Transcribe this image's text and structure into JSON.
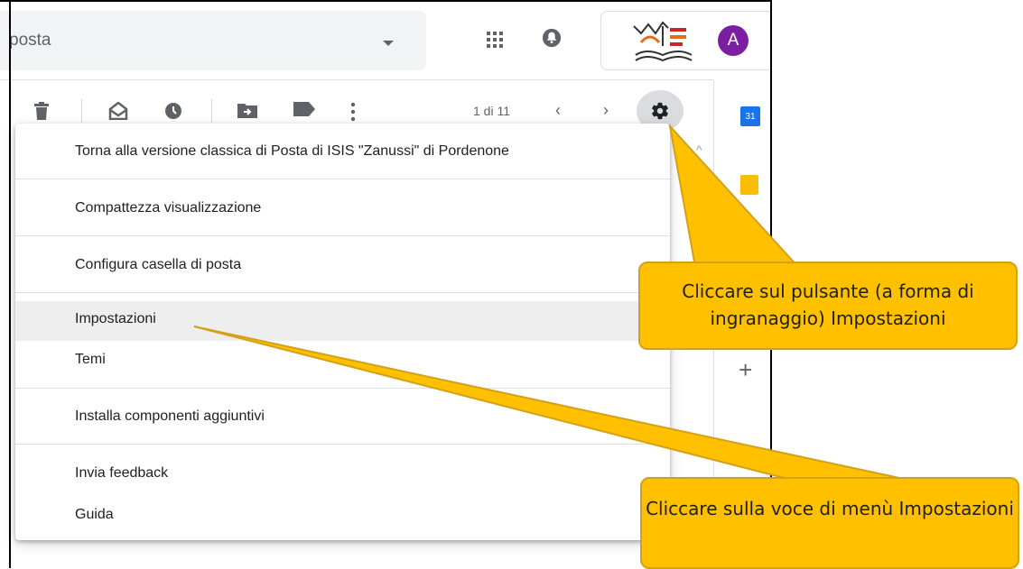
{
  "header": {
    "search_text": "posta",
    "avatar_letter": "A"
  },
  "toolbar": {
    "pager": "1 di 11",
    "prev": "‹",
    "next": "›"
  },
  "side_rail": {
    "calendar_label": "31",
    "add_label": "+"
  },
  "menu": {
    "items": [
      {
        "label": "Torna alla versione classica di Posta di ISIS \"Zanussi\" di Pordenone"
      },
      {
        "label": "Compattezza visualizzazione"
      },
      {
        "label": "Configura casella di posta"
      },
      {
        "label": "Impostazioni"
      },
      {
        "label": "Temi"
      },
      {
        "label": "Installa componenti aggiuntivi"
      },
      {
        "label": "Invia feedback"
      },
      {
        "label": "Guida"
      }
    ]
  },
  "callouts": {
    "gear": "Cliccare sul pulsante (a forma di ingranaggio)  Impostazioni",
    "menu_item": "Cliccare sulla voce di menù Impostazioni"
  },
  "colors": {
    "callout": "#ffc000",
    "avatar": "#7b1fa2",
    "highlight": "#eeeeee"
  }
}
